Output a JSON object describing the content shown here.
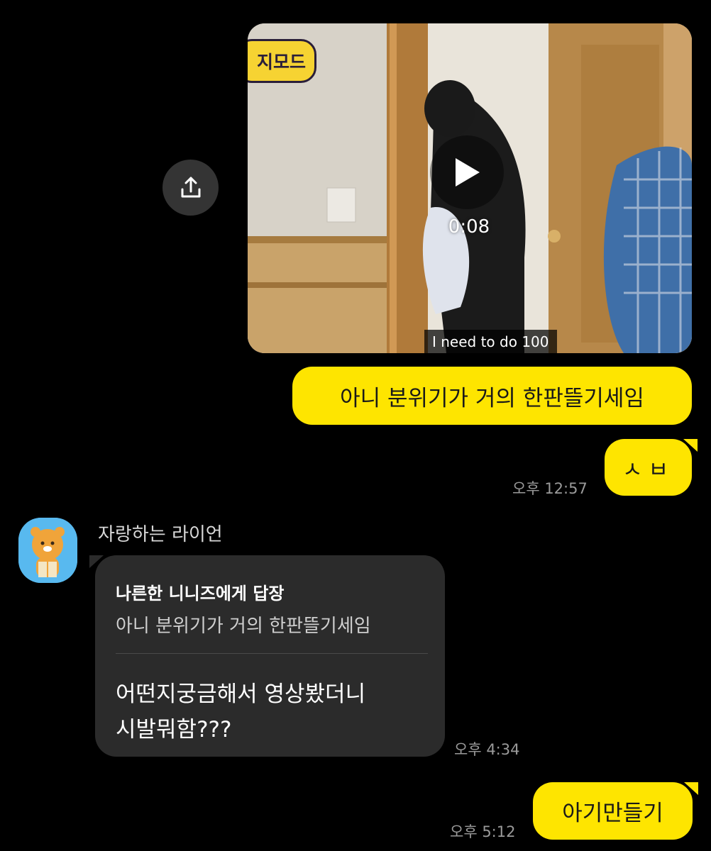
{
  "video": {
    "duration": "0:08",
    "caption": "I need to do 100",
    "badge_text": "지모드"
  },
  "messages": {
    "out1": "아니 분위기가 거의 한판뜰기세임",
    "out2": "ㅅㅂ",
    "time1": "오후 12:57",
    "sender_name": "자랑하는 라이언",
    "reply_title": "나른한 니니즈에게 답장",
    "reply_quote": "아니 분위기가 거의 한판뜰기세임",
    "in_line1": "어떤지궁금해서 영상봤더니",
    "in_line2": "시발뭐함???",
    "time2": "오후 4:34",
    "out3": "아기만들기",
    "time3": "오후 5:12"
  },
  "icons": {
    "share": "share-icon",
    "play": "play-icon",
    "avatar": "ryan-character-avatar"
  },
  "colors": {
    "background": "#000000",
    "outgoing_bubble": "#fee500",
    "incoming_bubble": "#2b2b2b",
    "timestamp": "#9a9a9a"
  }
}
